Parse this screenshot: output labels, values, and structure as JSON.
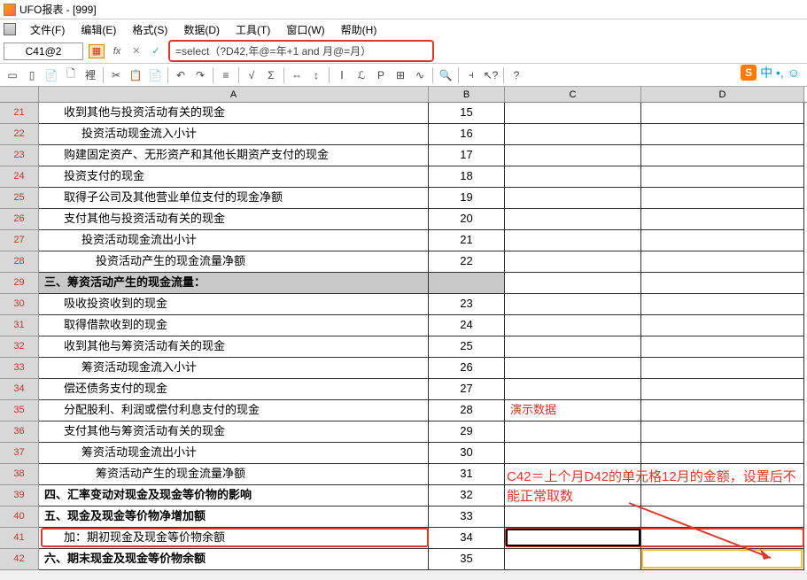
{
  "title": "UFO报表 - [999]",
  "menu": {
    "file": "文件(F)",
    "edit": "编辑(E)",
    "format": "格式(S)",
    "data": "数据(D)",
    "tool": "工具(T)",
    "window": "窗口(W)",
    "help": "帮助(H)"
  },
  "cell_ref": "C41@2",
  "fb_icons": {
    "fx": "fx",
    "x": "✕",
    "check": "✓"
  },
  "formula": "=select（?D42,年@=年+1 and 月@=月）",
  "ime": {
    "badge": "S",
    "txt": "中 •, ☺"
  },
  "cols": {
    "a": "A",
    "b": "B",
    "c": "C",
    "d": "D"
  },
  "rows": [
    {
      "n": "21",
      "a": "收到其他与投资活动有关的现金",
      "b": "15",
      "cls": "ind1"
    },
    {
      "n": "22",
      "a": "投资活动现金流入小计",
      "b": "16",
      "cls": "ind2"
    },
    {
      "n": "23",
      "a": "购建固定资产、无形资产和其他长期资产支付的现金",
      "b": "17",
      "cls": "ind1"
    },
    {
      "n": "24",
      "a": "投资支付的现金",
      "b": "18",
      "cls": "ind1"
    },
    {
      "n": "25",
      "a": "取得子公司及其他营业单位支付的现金净额",
      "b": "19",
      "cls": "ind1"
    },
    {
      "n": "26",
      "a": "支付其他与投资活动有关的现金",
      "b": "20",
      "cls": "ind1"
    },
    {
      "n": "27",
      "a": "投资活动现金流出小计",
      "b": "21",
      "cls": "ind2"
    },
    {
      "n": "28",
      "a": "投资活动产生的现金流量净额",
      "b": "22",
      "cls": "ind3"
    },
    {
      "n": "29",
      "a": "三、筹资活动产生的现金流量：",
      "b": "",
      "cls": "",
      "sect": true
    },
    {
      "n": "30",
      "a": "吸收投资收到的现金",
      "b": "23",
      "cls": "ind1"
    },
    {
      "n": "31",
      "a": "取得借款收到的现金",
      "b": "24",
      "cls": "ind1"
    },
    {
      "n": "32",
      "a": "收到其他与筹资活动有关的现金",
      "b": "25",
      "cls": "ind1"
    },
    {
      "n": "33",
      "a": "筹资活动现金流入小计",
      "b": "26",
      "cls": "ind2"
    },
    {
      "n": "34",
      "a": "偿还债务支付的现金",
      "b": "27",
      "cls": "ind1"
    },
    {
      "n": "35",
      "a": "分配股利、利润或偿付利息支付的现金",
      "b": "28",
      "cls": "ind1",
      "demo": "演示数据"
    },
    {
      "n": "36",
      "a": "支付其他与筹资活动有关的现金",
      "b": "29",
      "cls": "ind1"
    },
    {
      "n": "37",
      "a": "筹资活动现金流出小计",
      "b": "30",
      "cls": "ind2"
    },
    {
      "n": "38",
      "a": "筹资活动产生的现金流量净额",
      "b": "31",
      "cls": "ind3"
    },
    {
      "n": "39",
      "a": "四、汇率变动对现金及现金等价物的影响",
      "b": "32",
      "cls": "",
      "bold": true
    },
    {
      "n": "40",
      "a": "五、现金及现金等价物净增加额",
      "b": "33",
      "cls": "",
      "bold": true
    },
    {
      "n": "41",
      "a": "加：期初现金及现金等价物余额",
      "b": "34",
      "cls": "ind1"
    },
    {
      "n": "42",
      "a": "六、期末现金及现金等价物余额",
      "b": "35",
      "cls": "",
      "bold": true
    }
  ],
  "annotation": "C42＝上个月D42的单元格12月的金额，设置后不能正常取数",
  "tb": [
    "▭",
    "▯",
    "📄",
    "🗋",
    "裡",
    "|",
    "✂",
    "📋",
    "📄",
    "|",
    "↶",
    "↷",
    "|",
    "≡",
    "|",
    "√",
    "Σ",
    "|",
    "⇔",
    "↕",
    "|",
    "Ⅰ",
    "ℒ",
    "Ρ",
    "⊞",
    "∿",
    "|",
    "🔍",
    "|",
    "⫞",
    "↖?",
    "|",
    "?"
  ]
}
